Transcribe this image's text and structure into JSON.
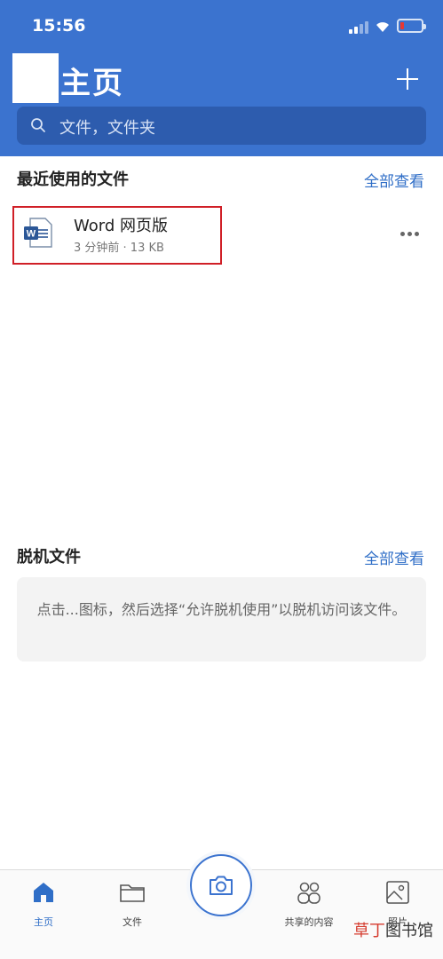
{
  "status_bar": {
    "time": "15:56"
  },
  "header": {
    "title": "主页",
    "add_icon": "plus-icon",
    "background": "#3b73cf"
  },
  "search": {
    "placeholder": "文件，文件夹",
    "icon": "search-icon"
  },
  "recent": {
    "title": "最近使用的文件",
    "see_all": "全部查看",
    "files": [
      {
        "name": "Word 网页版",
        "meta": "3 分钟前 · 13 KB",
        "icon": "word-document-icon"
      }
    ]
  },
  "offline": {
    "title": "脱机文件",
    "see_all": "全部查看",
    "empty_message": "点击...图标，然后选择“允许脱机使用”以脱机访问该文件。"
  },
  "tabs": [
    {
      "label": "主页",
      "icon": "home-icon",
      "active": true
    },
    {
      "label": "文件",
      "icon": "folder-icon",
      "active": false
    },
    {
      "label": "共享的内容",
      "icon": "shared-people-icon",
      "active": false
    },
    {
      "label": "照片",
      "icon": "photo-icon",
      "active": false
    }
  ],
  "camera": {
    "icon": "camera-icon"
  },
  "watermark": {
    "accent": "草丁",
    "rest": "图书馆"
  },
  "colors": {
    "accent": "#2f6ec7",
    "highlight_border": "#d01f27"
  }
}
